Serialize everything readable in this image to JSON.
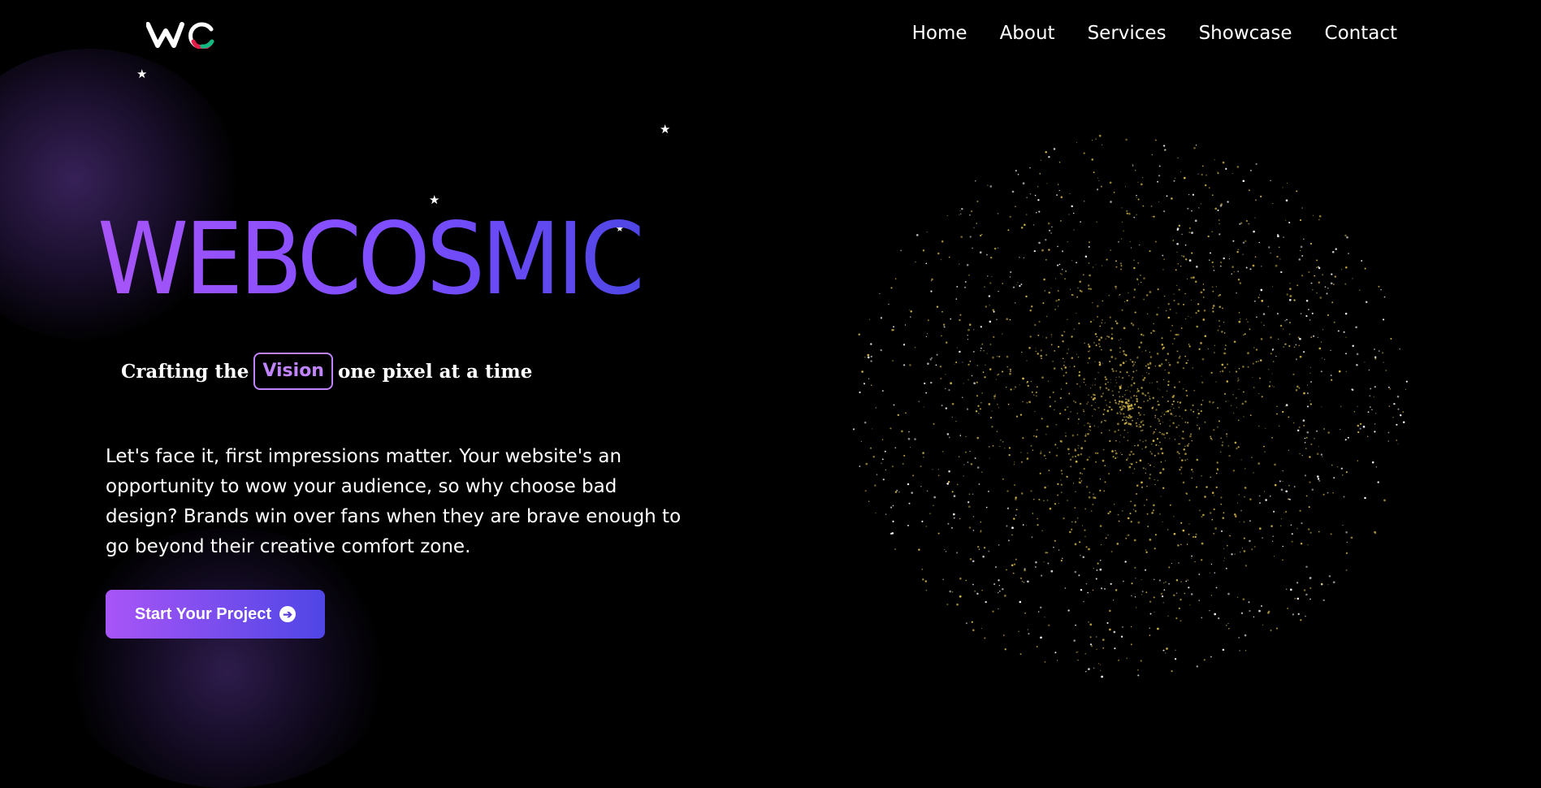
{
  "brand": {
    "logo_alt": "WC"
  },
  "nav": {
    "items": [
      {
        "label": "Home"
      },
      {
        "label": "About"
      },
      {
        "label": "Services"
      },
      {
        "label": "Showcase"
      },
      {
        "label": "Contact"
      }
    ]
  },
  "hero": {
    "title": "WEBCOSMIC",
    "tagline_before": "Crafting the",
    "tagline_highlight": "Vision",
    "tagline_after": "one pixel at a time",
    "description": "Let's face it, first impressions matter. Your website's an opportunity to wow your audience, so why choose bad design? Brands win over fans when they are brave enough to go beyond their creative comfort zone.",
    "cta_label": "Start Your Project",
    "cta_icon": "arrow-circle-right-icon"
  },
  "decorations": {
    "star_glyph": "★"
  },
  "colors": {
    "background": "#000000",
    "accent_start": "#a855f7",
    "accent_end": "#4f46e5",
    "highlight": "#c084fc",
    "particle": "#d4b84a"
  }
}
